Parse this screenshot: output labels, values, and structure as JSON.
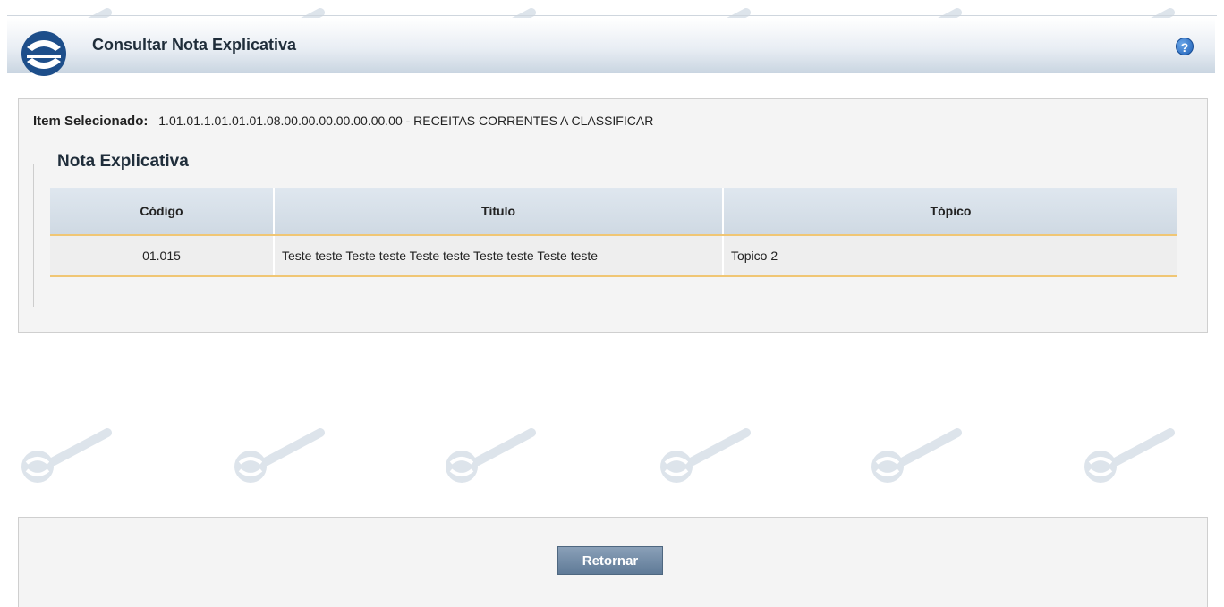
{
  "header": {
    "title": "Consultar Nota Explicativa",
    "help_icon": "help-icon"
  },
  "selected_item": {
    "label": "Item Selecionado:",
    "value": "1.01.01.1.01.01.01.08.00.00.00.00.00.00.00 - RECEITAS CORRENTES A CLASSIFICAR"
  },
  "nota_section": {
    "legend": "Nota Explicativa",
    "columns": [
      "Código",
      "Título",
      "Tópico"
    ],
    "rows": [
      {
        "codigo": "01.015",
        "titulo": "Teste teste Teste teste Teste teste Teste teste Teste teste",
        "topico": "Topico 2"
      }
    ]
  },
  "footer": {
    "return_label": "Retornar"
  },
  "colors": {
    "accent": "#5f7a97",
    "row_border": "#f0c674",
    "header_gradient_end": "#c9d5e1"
  }
}
